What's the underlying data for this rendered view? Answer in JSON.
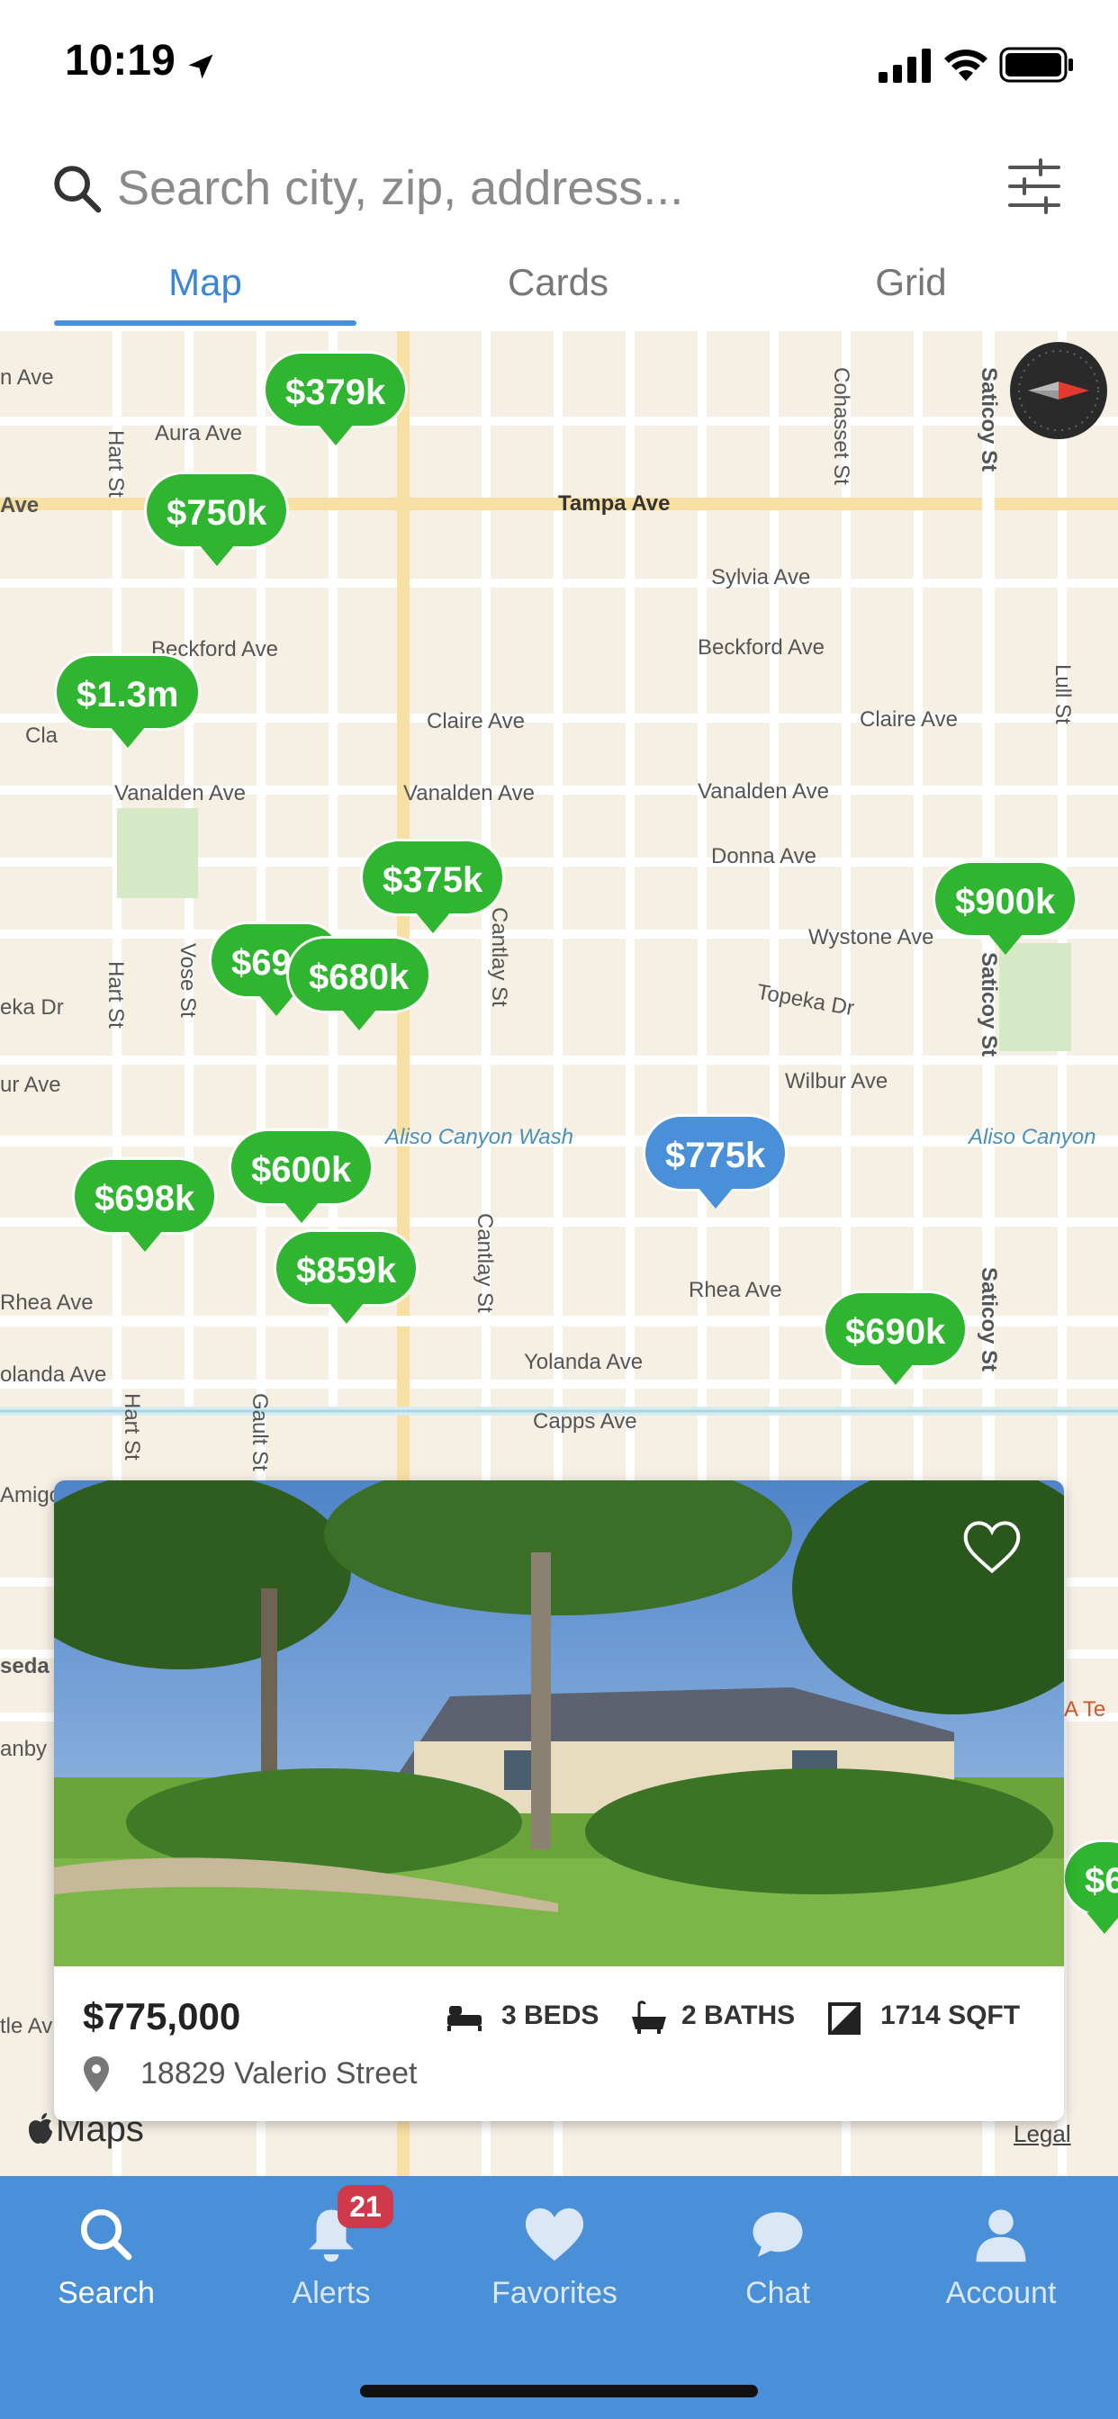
{
  "status_bar": {
    "time": "10:19"
  },
  "search": {
    "placeholder": "Search city, zip, address..."
  },
  "tabs": [
    {
      "label": "Map",
      "active": true
    },
    {
      "label": "Cards",
      "active": false
    },
    {
      "label": "Grid",
      "active": false
    }
  ],
  "map": {
    "streets": [
      "Aura Ave",
      "Tampa Ave",
      "Sylvia Ave",
      "Beckford Ave",
      "Beckford Ave",
      "Claire Ave",
      "Claire Ave",
      "Vanalden Ave",
      "Vanalden Ave",
      "Vanalden Ave",
      "Donna Ave",
      "Wystone Ave",
      "Topeka Dr",
      "Wilbur Ave",
      "Aliso Canyon Wash",
      "Aliso Canyon",
      "Rhea Ave",
      "Rhea Ave",
      "Yolanda Ave",
      "olanda Ave",
      "Capps Ave",
      "Hart St",
      "Hart St",
      "Hart St",
      "Vose St",
      "Cantlay St",
      "Cantlay St",
      "Cohasset St",
      "Saticoy St",
      "Saticoy St",
      "Saticoy St",
      "Lull St",
      "Gault St",
      "n Ave",
      "Ave",
      "eka Dr",
      "ur Ave",
      "Amigo",
      "seda",
      "anby",
      "A Te",
      "tle Av",
      "Cla"
    ],
    "pins": [
      {
        "label": "$379k",
        "selected": false
      },
      {
        "label": "$750k",
        "selected": false
      },
      {
        "label": "$1.3m",
        "selected": false
      },
      {
        "label": "$375k",
        "selected": false
      },
      {
        "label": "$900k",
        "selected": false
      },
      {
        "label": "$69",
        "selected": false
      },
      {
        "label": "$680k",
        "selected": false
      },
      {
        "label": "$775k",
        "selected": true
      },
      {
        "label": "$600k",
        "selected": false
      },
      {
        "label": "$698k",
        "selected": false
      },
      {
        "label": "$859k",
        "selected": false
      },
      {
        "label": "$690k",
        "selected": false
      },
      {
        "label": "$6",
        "selected": false
      }
    ],
    "attribution": "Maps",
    "legal": "Legal"
  },
  "listing": {
    "price": "$775,000",
    "beds": "3 BEDS",
    "baths": "2 BATHS",
    "sqft": "1714 SQFT",
    "address": "18829 Valerio Street"
  },
  "bottom_nav": [
    {
      "label": "Search",
      "icon": "search-icon",
      "active": true
    },
    {
      "label": "Alerts",
      "icon": "bell-icon",
      "badge": "21"
    },
    {
      "label": "Favorites",
      "icon": "heart-icon"
    },
    {
      "label": "Chat",
      "icon": "chat-icon"
    },
    {
      "label": "Account",
      "icon": "person-icon"
    }
  ],
  "colors": {
    "accent": "#4a90d9",
    "pin_green": "#2fb52f",
    "badge_red": "#d0384b"
  }
}
